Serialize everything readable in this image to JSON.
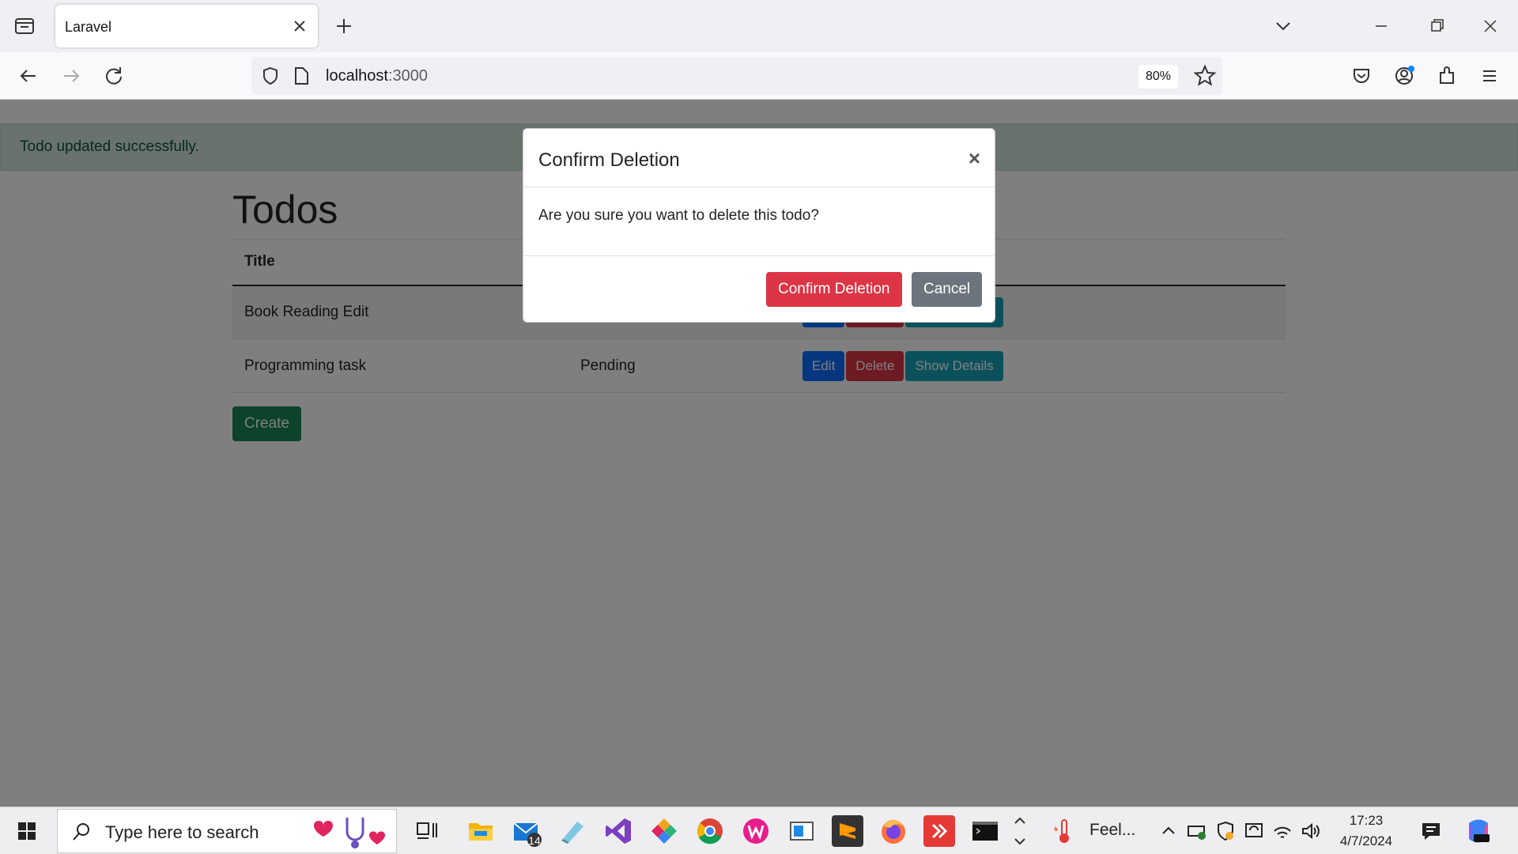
{
  "browser": {
    "tab_title": "Laravel",
    "url_host": "localhost",
    "url_port": ":3000",
    "zoom": "80%"
  },
  "page": {
    "alert": "Todo updated successfully.",
    "title": "Todos",
    "table": {
      "header": "Title",
      "rows": [
        {
          "title": "Book Reading Edit",
          "status": "",
          "actions": [
            "Edit",
            "Delete",
            "Show Details"
          ]
        },
        {
          "title": "Programming task",
          "status": "Pending",
          "actions": [
            "Edit",
            "Delete",
            "Show Details"
          ]
        }
      ]
    },
    "create_label": "Create"
  },
  "modal": {
    "title": "Confirm Deletion",
    "close": "×",
    "message": "Are you sure you want to delete this todo?",
    "confirm_label": "Confirm Deletion",
    "cancel_label": "Cancel"
  },
  "taskbar": {
    "search_placeholder": "Type here to search",
    "mail_badge": "14",
    "weather_label": "Feel...",
    "time": "17:23",
    "date": "4/7/2024"
  }
}
